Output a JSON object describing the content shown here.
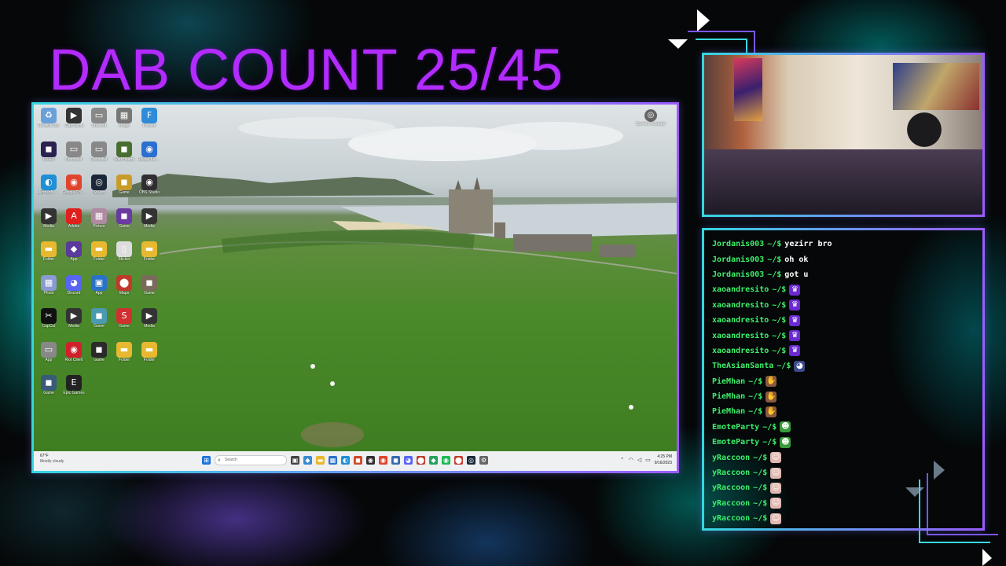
{
  "overlay": {
    "title": "DAB COUNT 25/45",
    "colors": {
      "title": "#b22bff",
      "frame_start": "#35d6e0",
      "frame_end": "#9a5bff",
      "chat_user": "#3cf06a"
    }
  },
  "desktop": {
    "icons": [
      {
        "label": "Recycle Bin",
        "icon": "recycle-bin-icon",
        "glyph": "♻",
        "color": "#6aa0d8"
      },
      {
        "label": "Clipchamp",
        "icon": "play-icon",
        "glyph": "▶",
        "color": "#333"
      },
      {
        "label": "Shortcut",
        "icon": "shortcut-icon",
        "glyph": "▭",
        "color": "#888"
      },
      {
        "label": "Image",
        "icon": "image-icon",
        "glyph": "▦",
        "color": "#777"
      },
      {
        "label": "Fortnite",
        "icon": "fortnite-icon",
        "glyph": "F",
        "color": "#2e8bd8"
      },
      {
        "label": "CSGO",
        "icon": "game-icon",
        "glyph": "◼",
        "color": "#2a2250"
      },
      {
        "label": "Controller",
        "icon": "controller-icon",
        "glyph": "▭",
        "color": "#888"
      },
      {
        "label": "Controller",
        "icon": "controller-icon",
        "glyph": "▭",
        "color": "#888"
      },
      {
        "label": "Wild Hearts",
        "icon": "game-icon",
        "glyph": "◼",
        "color": "#4a6e30"
      },
      {
        "label": "Rocket League",
        "icon": "rocket-icon",
        "glyph": "◉",
        "color": "#2b6fd0"
      },
      {
        "label": "Microsoft Edge",
        "icon": "edge-icon",
        "glyph": "◐",
        "color": "#1f8fd6"
      },
      {
        "label": "Google Chrome",
        "icon": "chrome-icon",
        "glyph": "◉",
        "color": "#e0442f"
      },
      {
        "label": "Steam",
        "icon": "steam-icon",
        "glyph": "◎",
        "color": "#1b2838"
      },
      {
        "label": "Game",
        "icon": "game-icon",
        "glyph": "◼",
        "color": "#c89b2a"
      },
      {
        "label": "OBS Studio",
        "icon": "obs-icon",
        "glyph": "◉",
        "color": "#302e31"
      },
      {
        "label": "Media",
        "icon": "play-icon",
        "glyph": "▶",
        "color": "#333"
      },
      {
        "label": "Adobe",
        "icon": "adobe-icon",
        "glyph": "A",
        "color": "#e0201c"
      },
      {
        "label": "Picture",
        "icon": "image-icon",
        "glyph": "▦",
        "color": "#b08aa0"
      },
      {
        "label": "Game",
        "icon": "game-icon",
        "glyph": "◼",
        "color": "#6a3aa0"
      },
      {
        "label": "Media",
        "icon": "play-icon",
        "glyph": "▶",
        "color": "#333"
      },
      {
        "label": "Folder",
        "icon": "folder-icon",
        "glyph": "▬",
        "color": "#e8b930"
      },
      {
        "label": "App",
        "icon": "app-icon",
        "glyph": "◆",
        "color": "#5a3a9a"
      },
      {
        "label": "Folder",
        "icon": "folder-icon",
        "glyph": "▬",
        "color": "#e8b930"
      },
      {
        "label": "Sticker",
        "icon": "file-icon",
        "glyph": "▯",
        "color": "#ddd"
      },
      {
        "label": "Folder",
        "icon": "folder-icon",
        "glyph": "▬",
        "color": "#e8b930"
      },
      {
        "label": "Photo",
        "icon": "image-icon",
        "glyph": "▦",
        "color": "#8a9ad0"
      },
      {
        "label": "Discord",
        "icon": "discord-icon",
        "glyph": "◕",
        "color": "#5865f2"
      },
      {
        "label": "App",
        "icon": "window-icon",
        "glyph": "▣",
        "color": "#2a72c8"
      },
      {
        "label": "Maps",
        "icon": "map-pin-icon",
        "glyph": "⬤",
        "color": "#c03a2a"
      },
      {
        "label": "Game",
        "icon": "game-icon",
        "glyph": "◼",
        "color": "#7a6a5a"
      },
      {
        "label": "CapCut",
        "icon": "capcut-icon",
        "glyph": "✂",
        "color": "#111"
      },
      {
        "label": "Media",
        "icon": "play-icon",
        "glyph": "▶",
        "color": "#333"
      },
      {
        "label": "Game",
        "icon": "game-icon",
        "glyph": "◼",
        "color": "#4a9ab0"
      },
      {
        "label": "Game",
        "icon": "game-icon",
        "glyph": "S",
        "color": "#d03030"
      },
      {
        "label": "Media",
        "icon": "play-icon",
        "glyph": "▶",
        "color": "#333"
      },
      {
        "label": "App",
        "icon": "app-icon",
        "glyph": "▭",
        "color": "#888"
      },
      {
        "label": "Riot Client",
        "icon": "riot-icon",
        "glyph": "◉",
        "color": "#d0202c"
      },
      {
        "label": "Game",
        "icon": "game-icon",
        "glyph": "◼",
        "color": "#2a2a2a"
      },
      {
        "label": "Folder",
        "icon": "folder-icon",
        "glyph": "▬",
        "color": "#e8b930"
      },
      {
        "label": "Folder",
        "icon": "folder-icon",
        "glyph": "▬",
        "color": "#e8b930"
      },
      {
        "label": "Game",
        "icon": "game-icon",
        "glyph": "◼",
        "color": "#3a5a7a"
      },
      {
        "label": "Epic Games",
        "icon": "epic-icon",
        "glyph": "E",
        "color": "#222"
      }
    ],
    "recycle": {
      "label": "Screen Recorder",
      "icon": "screen-recorder-icon",
      "glyph": "◎"
    }
  },
  "taskbar": {
    "weather_title": "67°F",
    "weather_sub": "Mostly cloudy",
    "search_placeholder": "Search",
    "apps": [
      {
        "icon": "windows-start-icon",
        "glyph": "⊞",
        "color": "#1a73d8"
      },
      {
        "icon": "task-view-icon",
        "glyph": "▣",
        "color": "#444"
      },
      {
        "icon": "copilot-icon",
        "glyph": "◆",
        "color": "#3a8ad0"
      },
      {
        "icon": "file-explorer-icon",
        "glyph": "▬",
        "color": "#e8b930"
      },
      {
        "icon": "store-icon",
        "glyph": "▦",
        "color": "#2a72c8"
      },
      {
        "icon": "edge-icon",
        "glyph": "◐",
        "color": "#1f8fd6"
      },
      {
        "icon": "app-icon",
        "glyph": "◼",
        "color": "#d04a2a"
      },
      {
        "icon": "obs-icon",
        "glyph": "◉",
        "color": "#302e31"
      },
      {
        "icon": "chrome-icon",
        "glyph": "◉",
        "color": "#e0442f"
      },
      {
        "icon": "app-icon",
        "glyph": "◼",
        "color": "#3a6ab0"
      },
      {
        "icon": "discord-icon",
        "glyph": "◕",
        "color": "#5865f2"
      },
      {
        "icon": "maps-icon",
        "glyph": "⬤",
        "color": "#c03a2a"
      },
      {
        "icon": "app-icon",
        "glyph": "◆",
        "color": "#2aa060"
      },
      {
        "icon": "spotify-icon",
        "glyph": "◉",
        "color": "#1db954"
      },
      {
        "icon": "maps-icon",
        "glyph": "⬤",
        "color": "#c03a2a"
      },
      {
        "icon": "steam-icon",
        "glyph": "◎",
        "color": "#1b2838"
      },
      {
        "icon": "settings-icon",
        "glyph": "⚙",
        "color": "#666"
      }
    ],
    "time": "4:25 PM",
    "date": "9/16/2023"
  },
  "chat": {
    "messages": [
      {
        "user": "Jordanis003",
        "prompt": "~/$",
        "text": "yezirr bro"
      },
      {
        "user": "Jordanis003",
        "prompt": "~/$",
        "text": "oh ok"
      },
      {
        "user": "Jordanis003",
        "prompt": "~/$",
        "text": "got u"
      },
      {
        "user": "xaoandresito",
        "prompt": "~/$",
        "emote": "pepe-emote",
        "glyph": "♛",
        "color": "#6a2ad0"
      },
      {
        "user": "xaoandresito",
        "prompt": "~/$",
        "emote": "pepe-emote",
        "glyph": "♛",
        "color": "#6a2ad0"
      },
      {
        "user": "xaoandresito",
        "prompt": "~/$",
        "emote": "pepe-emote",
        "glyph": "♛",
        "color": "#6a2ad0"
      },
      {
        "user": "xaoandresito",
        "prompt": "~/$",
        "emote": "pepe-emote",
        "glyph": "♛",
        "color": "#6a2ad0"
      },
      {
        "user": "xaoandresito",
        "prompt": "~/$",
        "emote": "pepe-emote",
        "glyph": "♛",
        "color": "#6a2ad0"
      },
      {
        "user": "TheAsianSanta",
        "prompt": "~/$",
        "emote": "cat-emote",
        "glyph": "◕",
        "color": "#3a4a8a"
      },
      {
        "user": "PieMhan",
        "prompt": "~/$",
        "emote": "hand-emote",
        "glyph": "✋",
        "color": "#8a5a40"
      },
      {
        "user": "PieMhan",
        "prompt": "~/$",
        "emote": "hand-emote",
        "glyph": "✋",
        "color": "#8a5a40"
      },
      {
        "user": "PieMhan",
        "prompt": "~/$",
        "emote": "hand-emote",
        "glyph": "✋",
        "color": "#8a5a40"
      },
      {
        "user": "EmoteParty",
        "prompt": "~/$",
        "emote": "pepe-party-emote",
        "glyph": "☻",
        "color": "#3a9a3a"
      },
      {
        "user": "EmoteParty",
        "prompt": "~/$",
        "emote": "pepe-party-emote",
        "glyph": "☻",
        "color": "#3a9a3a"
      },
      {
        "user": "yRaccoon",
        "prompt": "~/$",
        "emote": "face-emote",
        "glyph": "☺",
        "color": "#e0b8b0"
      },
      {
        "user": "yRaccoon",
        "prompt": "~/$",
        "emote": "face-emote",
        "glyph": "☺",
        "color": "#e0b8b0"
      },
      {
        "user": "yRaccoon",
        "prompt": "~/$",
        "emote": "face-emote",
        "glyph": "☺",
        "color": "#e0b8b0"
      },
      {
        "user": "yRaccoon",
        "prompt": "~/$",
        "emote": "face-emote",
        "glyph": "☺",
        "color": "#e0b8b0"
      },
      {
        "user": "yRaccoon",
        "prompt": "~/$",
        "emote": "face-emote",
        "glyph": "☺",
        "color": "#e0b8b0"
      }
    ]
  }
}
